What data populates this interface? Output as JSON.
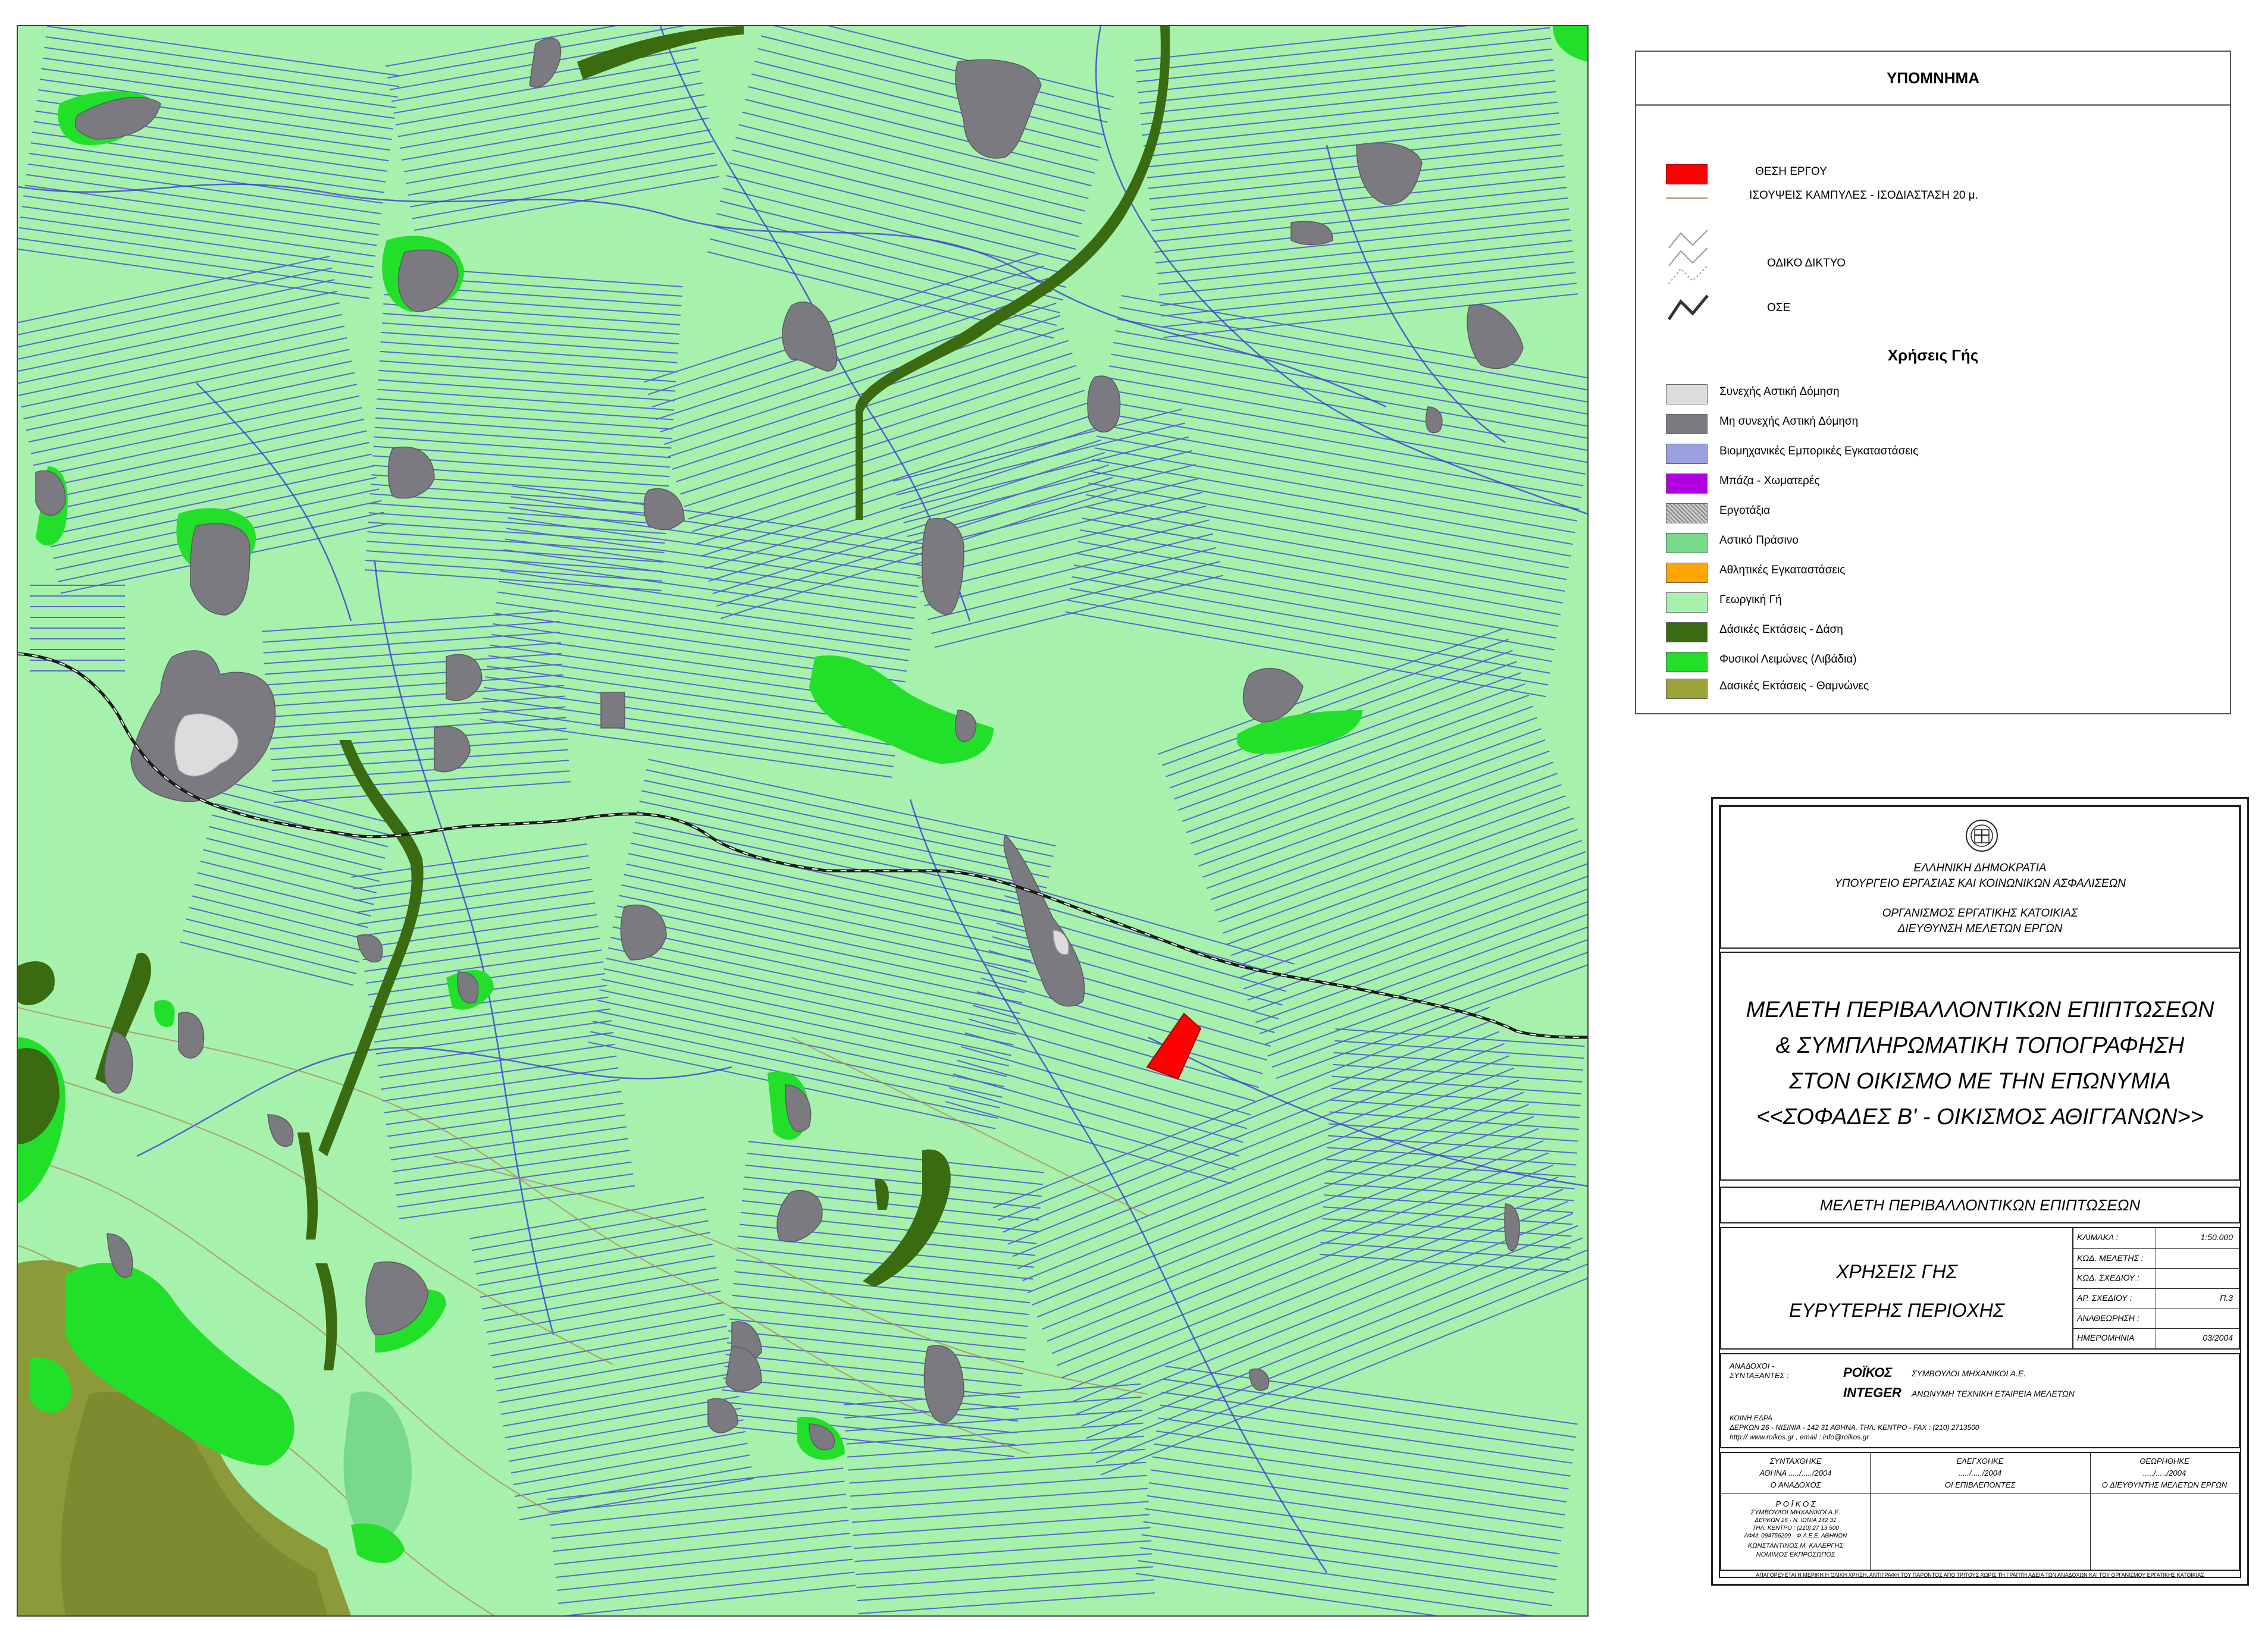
{
  "map": {
    "colors": {
      "agricultural": "#a6f2ad",
      "urban_discontinuous": "#7a7a80",
      "urban_continuous": "#dcdcdc",
      "meadows": "#22e02a",
      "forest": "#3a6b10",
      "shrubs": "#8c9a3a",
      "urban_green": "#77d989",
      "project_site": "#ff0000",
      "streams": "#3b3bd6",
      "contours": "#b08a5a",
      "railway": "#1a1a1a"
    }
  },
  "legend": {
    "title": "ΥΠΟΜΝΗΜΑ",
    "project_site": "ΘΕΣΗ ΕΡΓΟΥ",
    "contours": "ΙΣΟΥΨΕΙΣ ΚΑΜΠΥΛΕΣ - ΙΣΟΔΙΑΣΤΑΣΗ 20 μ.",
    "road_network": "ΟΔΙΚΟ ΔΙΚΤΥΟ",
    "railway": "ΟΣΕ",
    "land_use_title": "Χρήσεις Γής",
    "land_uses": [
      {
        "label": "Συνεχής Αστική Δόμηση",
        "color": "#dcdcdc"
      },
      {
        "label": "Μη συνεχής Αστική Δόμηση",
        "color": "#7a7a80"
      },
      {
        "label": "Βιομηχανικές Εμπορικές Εγκαταστάσεις",
        "color": "#9aa0e0"
      },
      {
        "label": "Μπάζα - Χωματερές",
        "color": "#b000e0"
      },
      {
        "label": "Εργοτάξια",
        "color": "#a0a0a0"
      },
      {
        "label": "Αστικό Πράσινο",
        "color": "#77d989"
      },
      {
        "label": "Αθλητικές Εγκαταστάσεις",
        "color": "#ffa500"
      },
      {
        "label": "Γεωργική Γή",
        "color": "#a6f2ad"
      },
      {
        "label": "Δάσικές Εκτάσεις - Δάση",
        "color": "#3a6b10"
      },
      {
        "label": "Φυσικοί Λειμώνες (Λιβάδια)",
        "color": "#22e02a"
      },
      {
        "label": "Δασικές Εκτάσεις - Θαμνώνες",
        "color": "#9aa43a"
      }
    ]
  },
  "title_block": {
    "org1": "ΕΛΛΗΝΙΚΗ ΔΗΜΟΚΡΑΤΙΑ",
    "org2": "ΥΠΟΥΡΓΕΙΟ ΕΡΓΑΣΙΑΣ ΚΑΙ ΚΟΙΝΩΝΙΚΩΝ ΑΣΦΑΛΙΣΕΩΝ",
    "org3": "ΟΡΓΑΝΙΣΜΟΣ ΕΡΓΑΤΙΚΗΣ ΚΑΤΟΙΚΙΑΣ",
    "org4": "ΔΙΕΥΘΥΝΣΗ ΜΕΛΕΤΩΝ ΕΡΓΩΝ",
    "project_line1": "ΜΕΛΕΤΗ ΠΕΡΙΒΑΛΛΟΝΤΙΚΩΝ ΕΠΙΠΤΩΣΕΩΝ",
    "project_line2": "& ΣΥΜΠΛΗΡΩΜΑΤΙΚΗ ΤΟΠΟΓΡΑΦΗΣΗ",
    "project_line3": "ΣΤΟΝ ΟΙΚΙΣΜΟ ΜΕ ΤΗΝ ΕΠΩΝΥΜΙΑ",
    "project_line4": "<<ΣΟΦΑΔΕΣ Β' - ΟΙΚΙΣΜΟΣ ΑΘΙΓΓΑΝΩΝ>>",
    "study": "ΜΕΛΕΤΗ ΠΕΡΙΒΑΛΛΟΝΤΙΚΩΝ ΕΠΙΠΤΩΣΕΩΝ",
    "drawing_title1": "ΧΡΗΣΕΙΣ ΓΗΣ",
    "drawing_title2": "ΕΥΡΥΤΕΡΗΣ ΠΕΡΙΟΧΗΣ",
    "fields": [
      {
        "label": "ΚΛΙΜΑΚΑ :",
        "value": "1:50.000"
      },
      {
        "label": "ΚΩΔ. ΜΕΛΕΤΗΣ :",
        "value": ""
      },
      {
        "label": "ΚΩΔ. ΣΧΕΔΙΟΥ :",
        "value": ""
      },
      {
        "label": "ΑΡ. ΣΧΕΔΙΟΥ :",
        "value": "Π.3"
      },
      {
        "label": "ΑΝΑΘΕΩΡΗΣΗ :",
        "value": ""
      },
      {
        "label": "ΗΜΕΡΟΜΗΝΙΑ",
        "value": "03/2004"
      }
    ],
    "contractors_label1": "ΑΝΑΔΟΧΟΙ -",
    "contractors_label2": "ΣΥΝΤΑΞΑΝΤΕΣ :",
    "contractor1_name": "ΡΟΪΚΟΣ",
    "contractor1_desc": "ΣΥΜΒΟΥΛΟΙ ΜΗΧΑΝΙΚΟΙ Α.Ε.",
    "contractor2_name": "INTEGER",
    "contractor2_desc": "ΑΝΩΝΥΜΗ ΤΕΧΝΙΚΗ ΕΤΑΙΡΕΙΑ ΜΕΛΕΤΩΝ",
    "address1": "ΚΟΙΝΗ ΕΔΡΑ",
    "address2": "ΔΕΡΚΩΝ 26 - ΝΙΣΙΝΙΑ - 142 31 ΑΘΗΝΑ, ΤΗΛ. ΚΕΝΤΡΟ - FAX : (210) 2713500",
    "address3": "http:// www.roikos.gr , email : info@roikos.gr",
    "sig1_title": "ΣΥΝΤΑΧΘΗΚΕ",
    "sig1_date": "ΑΘΗΝΑ ...../...../2004",
    "sig1_role": "Ο ΑΝΑΔΟΧΟΣ",
    "sig2_title": "ΕΛΕΓΧΘΗΚΕ",
    "sig2_date": "...../...../2004",
    "sig2_role": "ΟΙ ΕΠΙΒΛΕΠΟΝΤΕΣ",
    "sig3_title": "ΘΕΩΡΗΘΗΚΕ",
    "sig3_date": "...../...../2004",
    "sig3_role": "Ο ΔΙΕΥΘΥΝΤΗΣ ΜΕΛΕΤΩΝ ΕΡΓΩΝ",
    "stamp1": "Ρ Ο Ϊ Κ Ο Σ",
    "stamp2": "ΣΥΜΒΟΥΛΟΙ ΜΗΧΑΝΙΚΟΙ Α.Ε.",
    "stamp3": "ΔΕΡΚΩΝ 26 · Ν. ΙΩΝΙΑ 142 31",
    "stamp4": "ΤΗΛ. ΚΕΝΤΡΟ : (210) 27 13 500",
    "stamp5": "ΑΦΜ: 094756209 · Φ.Α.Ε.Ε. ΑΘΗΝΩΝ",
    "stamp6": "ΚΩΝΣΤΑΝΤΙΝΟΣ Μ. ΚΑΛΕΡΓΗΣ",
    "stamp7": "ΝΟΜΙΜΟΣ ΕΚΠΡΟΣΩΠΟΣ",
    "footer": "ΑΠΑΓΟΡΕΥΕΤΑΙ Η ΜΕΡΙΚΗ Η ΟΛΙΚΗ ΧΡΗΣΗ, ΑΝΤΙΓΡΑΦΗ ΤΟΥ ΠΑΡΟΝΤΟΣ ΑΠΟ ΤΡΙΤΟΥΣ ΧΩΡΙΣ ΤΗ ΓΡΑΠΤΗ ΑΔΕΙΑ ΤΩΝ ΑΝΑΔΟΧΩΝ ΚΑΙ ΤΟΥ ΟΡΓΑΝΙΣΜΟΥ ΕΡΓΑΤΙΚΗΣ ΚΑΤΟΙΚΙΑΣ"
  }
}
